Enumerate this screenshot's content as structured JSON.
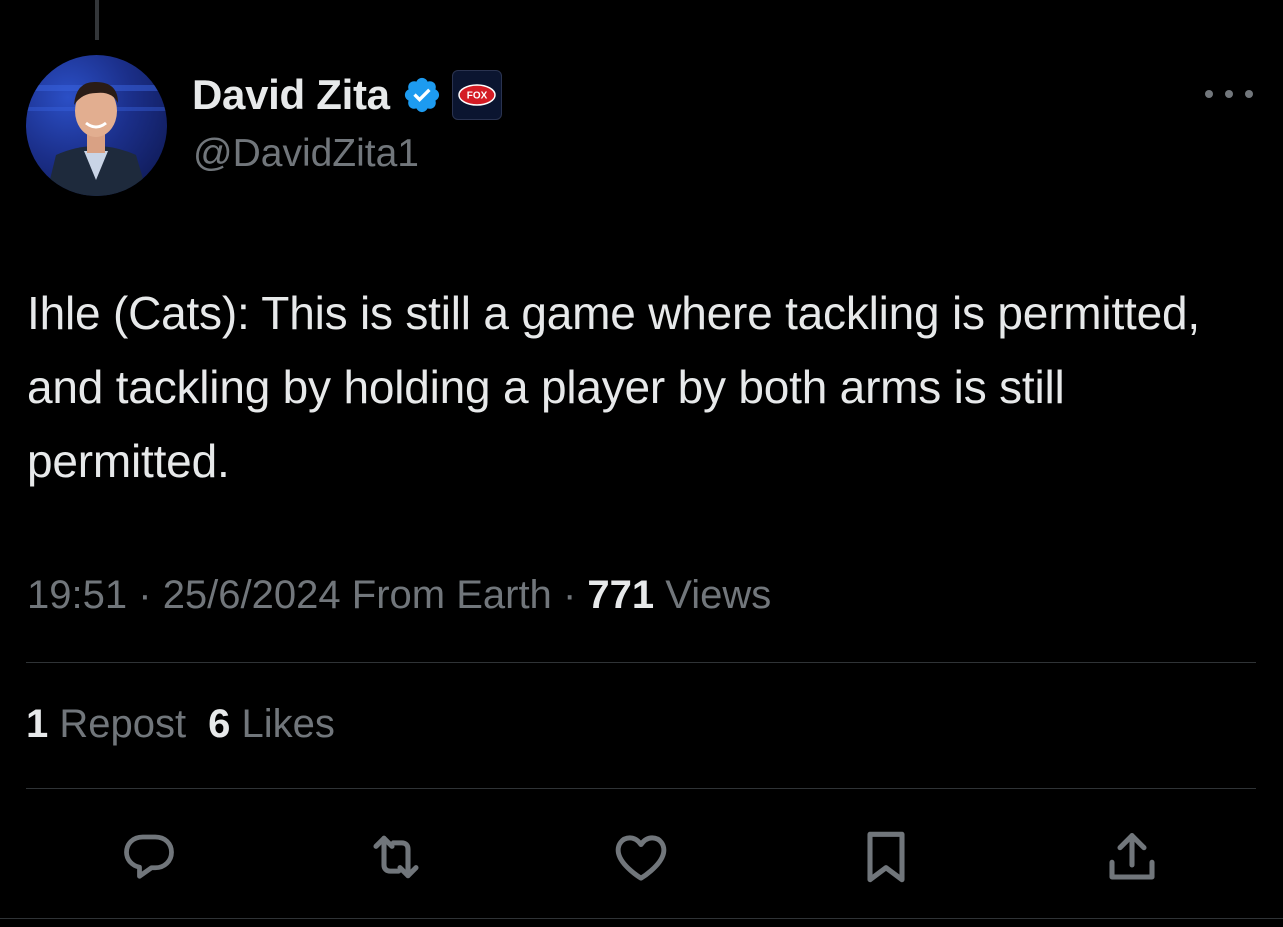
{
  "tweet": {
    "author": {
      "display_name": "David Zita",
      "handle": "@DavidZita1",
      "verified_icon": "verified-badge-icon",
      "affiliation_badge": "FOX"
    },
    "text": "Ihle (Cats): This is still a game where tackling is permitted, and tackling by holding a player by both arms is still permitted.",
    "meta": {
      "time": "19:51",
      "separator": "·",
      "date": "25/6/2024",
      "source": "From Earth",
      "views_count": "771",
      "views_label": "Views"
    },
    "stats": {
      "reposts_count": "1",
      "reposts_label": "Repost",
      "likes_count": "6",
      "likes_label": "Likes"
    },
    "actions": [
      "reply-icon",
      "repost-icon",
      "like-icon",
      "bookmark-icon",
      "share-icon"
    ]
  },
  "colors": {
    "background": "#000000",
    "primary_text": "#e7e9ea",
    "secondary_text": "#71767b",
    "divider": "#2f3336",
    "verified_blue": "#1d9bf0",
    "fox_red": "#d41c24"
  }
}
